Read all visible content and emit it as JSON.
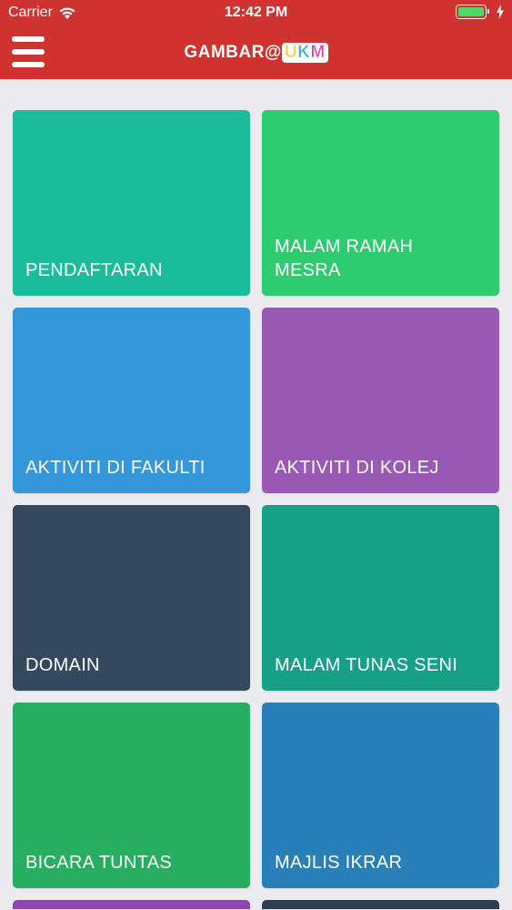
{
  "status_bar": {
    "carrier": "Carrier",
    "time": "12:42 PM",
    "battery_color": "#4cd964"
  },
  "nav": {
    "title": "GAMBAR@",
    "logo": {
      "u": "U",
      "k": "K",
      "m": "M"
    },
    "menu_icon": "hamburger-icon",
    "background": "#d0332f"
  },
  "tiles": [
    {
      "label": "PENDAFTARAN",
      "color": "#1abc9c"
    },
    {
      "label": "MALAM RAMAH MESRA",
      "color": "#2ecc71"
    },
    {
      "label": "AKTIVITI DI FAKULTI",
      "color": "#3498db"
    },
    {
      "label": "AKTIVITI DI KOLEJ",
      "color": "#9b59b6"
    },
    {
      "label": "DOMAIN",
      "color": "#34495e"
    },
    {
      "label": "MALAM TUNAS SENI",
      "color": "#16a085"
    },
    {
      "label": "BICARA TUNTAS",
      "color": "#27ae60"
    },
    {
      "label": "MAJLIS IKRAR",
      "color": "#2980b9"
    }
  ],
  "partial_tiles": [
    {
      "color": "#8e44ad"
    },
    {
      "color": "#2c3e50"
    }
  ]
}
